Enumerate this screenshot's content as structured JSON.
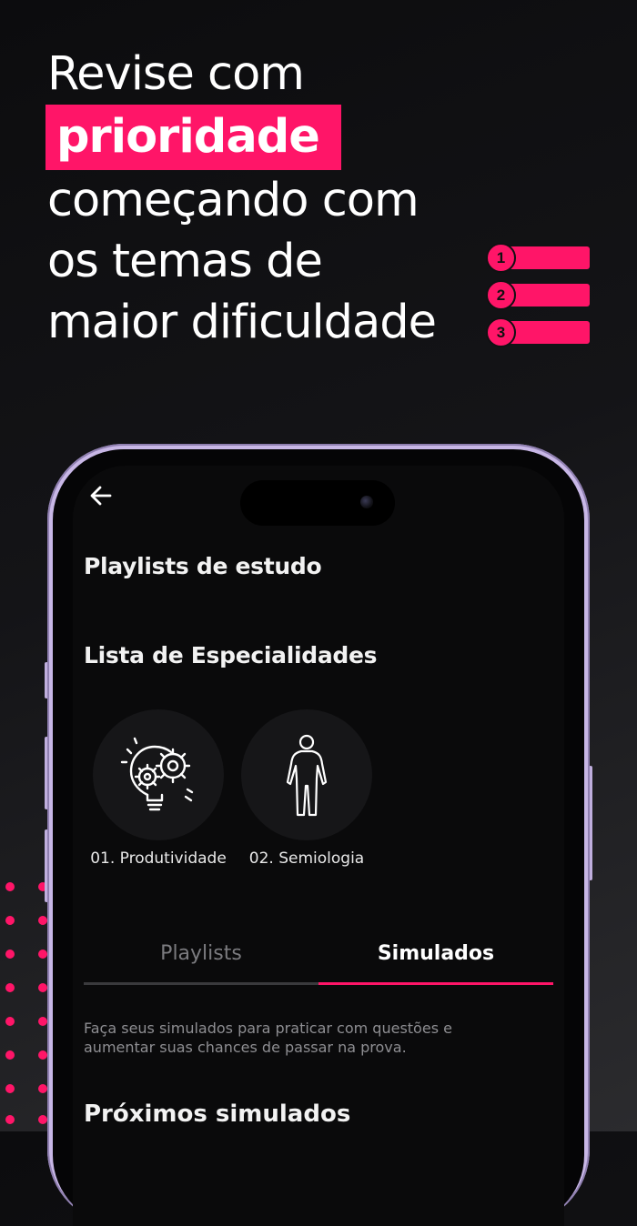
{
  "promo": {
    "line1": "Revise com",
    "highlight": "prioridade",
    "line3": "começando com",
    "line4": "os temas de",
    "line5": "maior dificuldade",
    "accent_color": "#ff1568"
  },
  "priority_list": [
    "1",
    "2",
    "3"
  ],
  "app": {
    "back_icon": "arrow-left-icon",
    "page_title": "Playlists de estudo",
    "section_title": "Lista de Especialidades",
    "specialties": [
      {
        "label": "01. Produtividade",
        "icon": "lightbulb-gears-icon"
      },
      {
        "label": "02. Semiologia",
        "icon": "human-body-icon"
      }
    ],
    "tabs": [
      {
        "label": "Playlists",
        "active": false
      },
      {
        "label": "Simulados",
        "active": true
      }
    ],
    "description": "Faça seus simulados para praticar com questões e aumentar suas chances de passar na prova.",
    "next_section_title": "Próximos simulados"
  }
}
